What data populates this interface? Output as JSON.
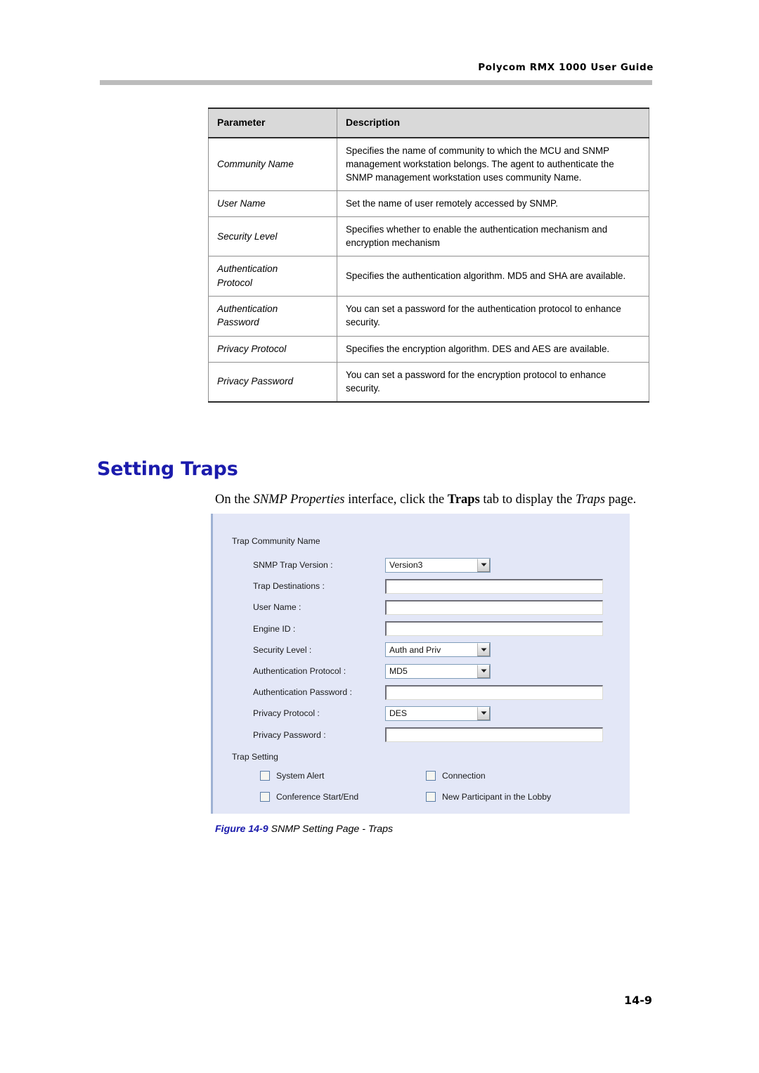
{
  "header": {
    "running_title": "Polycom RMX 1000 User Guide"
  },
  "parameter_table": {
    "columns": [
      "Parameter",
      "Description"
    ],
    "rows": [
      {
        "parameter": "Community Name",
        "description": "Specifies the name of community to which the MCU and SNMP management workstation belongs. The agent to authenticate the SNMP management workstation uses community Name."
      },
      {
        "parameter": "User Name",
        "description": "Set the name of user remotely accessed by SNMP."
      },
      {
        "parameter": "Security Level",
        "description": "Specifies whether to enable the authentication mechanism and encryption mechanism"
      },
      {
        "parameter": "Authentication\nProtocol",
        "description": "Specifies the authentication algorithm. MD5 and SHA are available."
      },
      {
        "parameter": "Authentication\nPassword",
        "description": "You can set a password for the authentication protocol to enhance security."
      },
      {
        "parameter": "Privacy Protocol",
        "description": "Specifies the encryption algorithm. DES and AES are available."
      },
      {
        "parameter": "Privacy Password",
        "description": "You can set a password for the encryption protocol to enhance security."
      }
    ]
  },
  "section": {
    "heading": "Setting Traps",
    "intro": {
      "part1": "On the ",
      "italic1": "SNMP Properties",
      "part2": " interface, click the ",
      "bold1": "Traps",
      "part3": " tab to display the ",
      "italic2": "Traps",
      "part4": " page."
    }
  },
  "app_screenshot": {
    "group_community_label": "Trap Community Name",
    "group_trap_setting_label": "Trap Setting",
    "fields": [
      {
        "label": "SNMP Trap Version :",
        "control": "select",
        "value": "Version3"
      },
      {
        "label": "Trap Destinations :",
        "control": "input",
        "value": ""
      },
      {
        "label": "User Name :",
        "control": "input",
        "value": ""
      },
      {
        "label": "Engine ID :",
        "control": "input",
        "value": ""
      },
      {
        "label": "Security Level :",
        "control": "select",
        "value": "Auth and Priv"
      },
      {
        "label": "Authentication Protocol :",
        "control": "select",
        "value": "MD5"
      },
      {
        "label": "Authentication Password :",
        "control": "input",
        "value": ""
      },
      {
        "label": "Privacy Protocol :",
        "control": "select",
        "value": "DES"
      },
      {
        "label": "Privacy Password :",
        "control": "input",
        "value": ""
      }
    ],
    "checkboxes": [
      {
        "label": "System Alert",
        "checked": false
      },
      {
        "label": "Connection",
        "checked": false
      },
      {
        "label": "Conference Start/End",
        "checked": false
      },
      {
        "label": "New Participant in the Lobby",
        "checked": false
      }
    ],
    "colors": {
      "panel_background": "#e3e7f7",
      "panel_edge": "#9fb2d4",
      "control_border": "#7f9db9"
    }
  },
  "figure": {
    "number": "Figure 14-9",
    "caption": " SNMP Setting Page - Traps"
  },
  "page": {
    "number": "14-9"
  }
}
